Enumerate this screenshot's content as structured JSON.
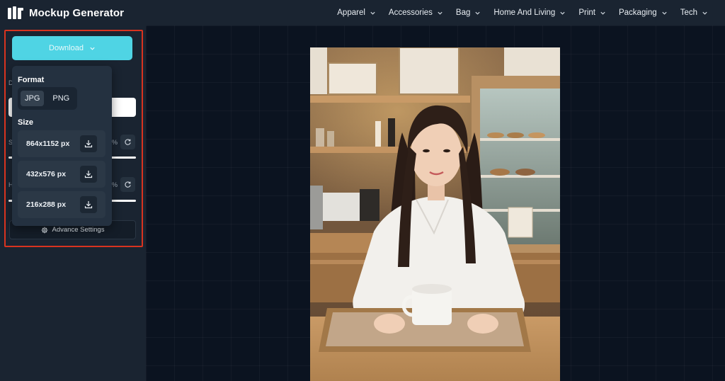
{
  "app": {
    "title": "Mockup Generator"
  },
  "nav": {
    "items": [
      {
        "label": "Apparel"
      },
      {
        "label": "Accessories"
      },
      {
        "label": "Bag"
      },
      {
        "label": "Home And Living"
      },
      {
        "label": "Print"
      },
      {
        "label": "Packaging"
      },
      {
        "label": "Tech"
      }
    ]
  },
  "sidebar": {
    "download_label": "Download",
    "advance_settings_label": "Advance Settings",
    "partial_labels": [
      "D",
      "S",
      "H"
    ],
    "partial_pct": [
      "%",
      "%"
    ]
  },
  "dropdown": {
    "format_heading": "Format",
    "formats": [
      "JPG",
      "PNG"
    ],
    "selected_format": "JPG",
    "size_heading": "Size",
    "sizes": [
      {
        "label": "864x1152 px"
      },
      {
        "label": "432x576 px"
      },
      {
        "label": "216x288 px"
      }
    ]
  },
  "colors": {
    "accent": "#4fd4e4",
    "highlight_border": "#d9331f",
    "header_bg": "#1a2431",
    "canvas_bg": "#0b1320"
  },
  "icons": {
    "logo": "logo-mark-icon",
    "chevron": "chevron-down-icon",
    "download": "download-icon",
    "reset": "refresh-icon",
    "gear": "gear-icon"
  }
}
